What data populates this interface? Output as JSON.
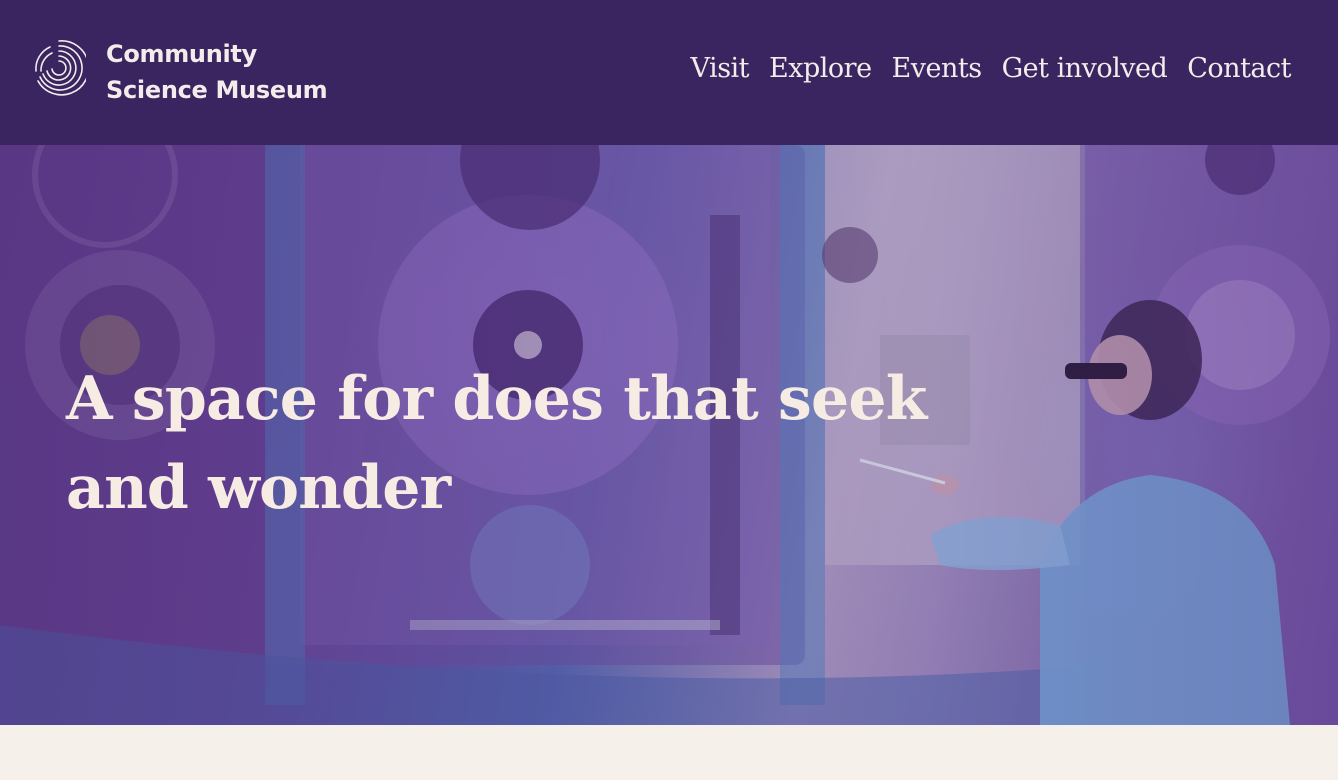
{
  "brand": {
    "name_line1": "Community",
    "name_line2": "Science Museum",
    "logo_icon": "spiral-rings-logo"
  },
  "nav": {
    "items": [
      {
        "label": "Visit"
      },
      {
        "label": "Explore"
      },
      {
        "label": "Events"
      },
      {
        "label": "Get involved"
      },
      {
        "label": "Contact"
      }
    ]
  },
  "hero": {
    "title": "A space for does that seek and wonder",
    "image": "scientist-with-vacuum-chamber-photo"
  },
  "colors": {
    "header_bg": "#3b2561",
    "text_light": "#f3ecea",
    "page_bg": "#f5f0ea"
  }
}
